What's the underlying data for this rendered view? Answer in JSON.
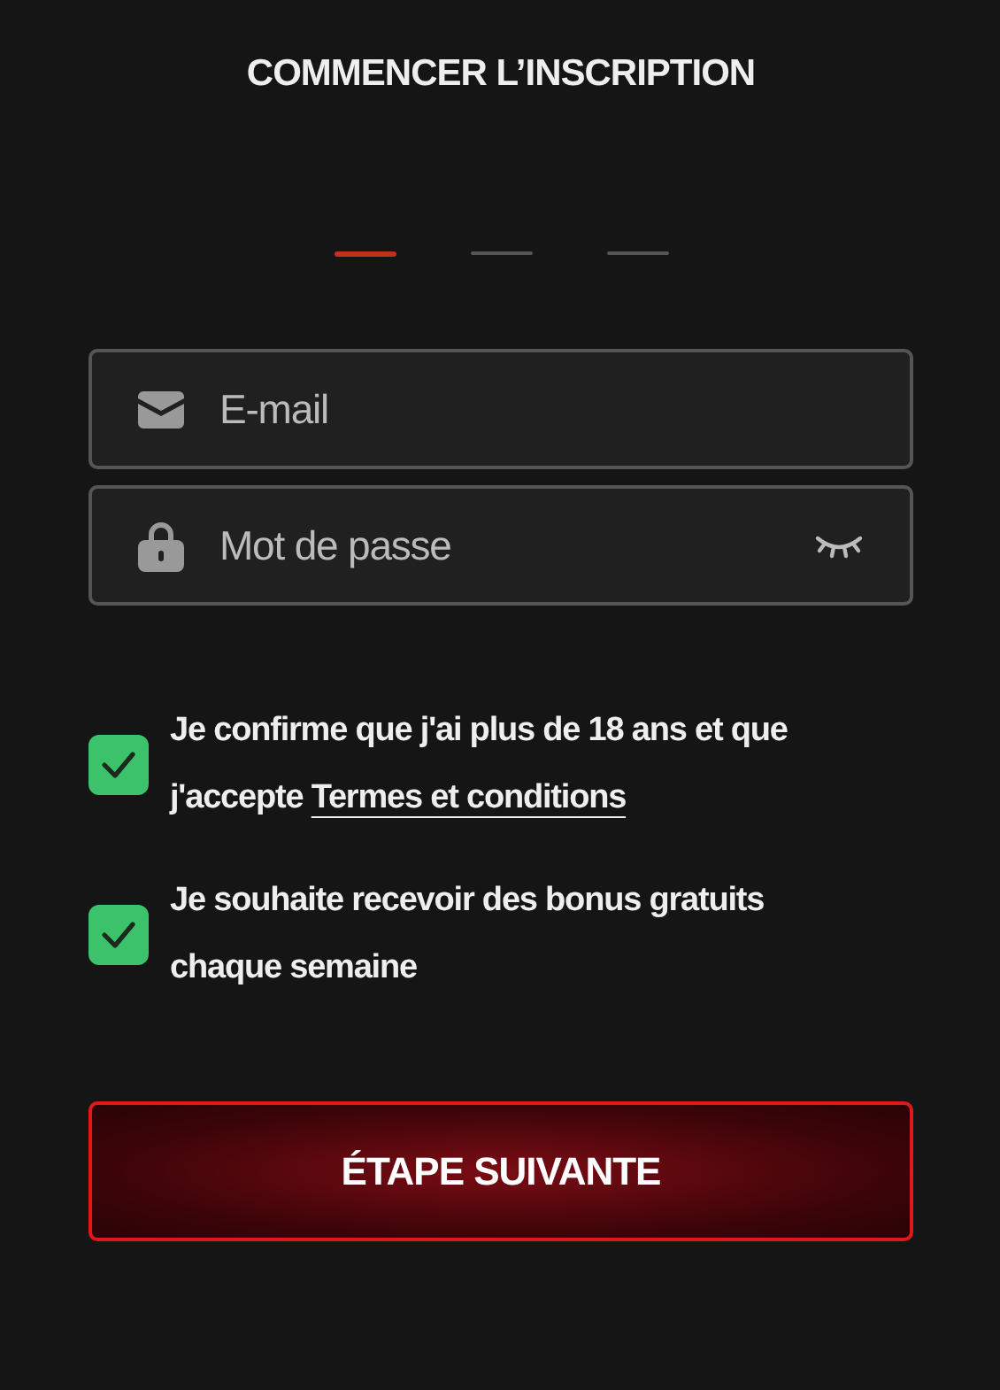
{
  "title": "COMMENCER L’INSCRIPTION",
  "steps": [
    {
      "selected": true
    },
    {
      "selected": false
    },
    {
      "selected": false
    }
  ],
  "fields": [
    {
      "kind": "email",
      "placeholder": "E-mail"
    },
    {
      "kind": "password",
      "placeholder": "Mot de passe"
    }
  ],
  "consents": [
    {
      "text": "Je confirme que j'ai plus de 18 ans et que j'accepte",
      "link": "Termes et conditions",
      "checked": true
    },
    {
      "text": "Je souhaite recevoir des bonus gratuits chaque semaine",
      "checked": true
    }
  ],
  "button": {
    "label": "ÉTAPE SUIVANTE"
  }
}
